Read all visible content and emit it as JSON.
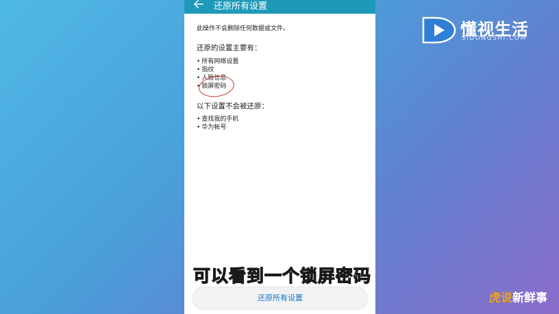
{
  "screen": {
    "title": "还原所有设置",
    "intro": "此操作不会删除任何数据或文件。",
    "reset_heading": "还原的设置主要有：",
    "reset_items": [
      "所有网络设置",
      "指纹",
      "人脸信息",
      "锁屏密码"
    ],
    "keep_heading": "以下设置不会被还原：",
    "keep_items": [
      "查找我的手机",
      "华为帐号"
    ],
    "action_button": "还原所有设置"
  },
  "overlay": {
    "subtitle": "可以看到一个锁屏密码",
    "logo_text": "懂视生活",
    "logo_sub": "SIDONGSHI.COM",
    "watermark_part1": "虎说",
    "watermark_part2": "新鲜事"
  },
  "icons": {
    "back": "arrow-left-icon",
    "logo": "play-logo-icon"
  },
  "colors": {
    "appbar": "#1e9ab8",
    "accent": "#1a73c8",
    "annotation": "#c0392b"
  }
}
